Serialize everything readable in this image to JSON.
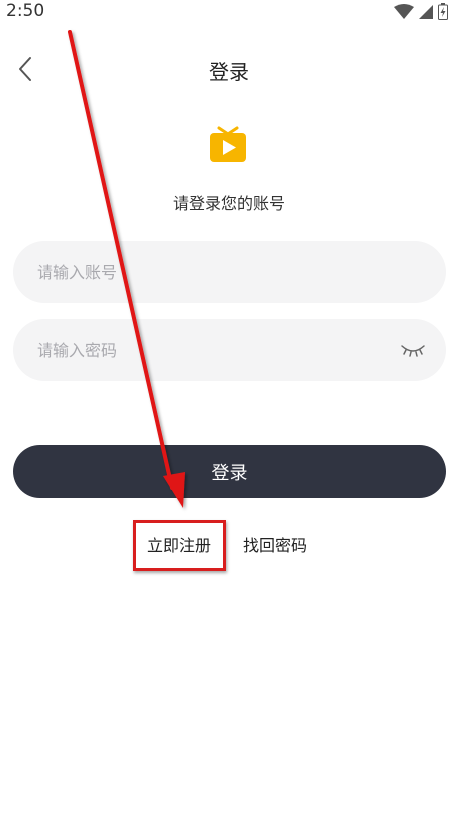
{
  "status_bar": {
    "time": "2:50",
    "icons": [
      "wifi-icon",
      "signal-icon",
      "battery-icon"
    ]
  },
  "header": {
    "title": "登录",
    "back_icon": "chevron-left-icon"
  },
  "logo": {
    "icon": "tv-play-icon",
    "color": "#f7b500"
  },
  "subtitle": "请登录您的账号",
  "form": {
    "account": {
      "value": "",
      "placeholder": "请输入账号"
    },
    "password": {
      "value": "",
      "placeholder": "请输入密码",
      "toggle_icon": "eye-closed-icon"
    },
    "submit_label": "登录"
  },
  "links": {
    "register": "立即注册",
    "forgot": "找回密码"
  },
  "colors": {
    "button_bg": "#303441",
    "field_bg": "#f4f4f5",
    "annotation": "#d81e1e"
  }
}
